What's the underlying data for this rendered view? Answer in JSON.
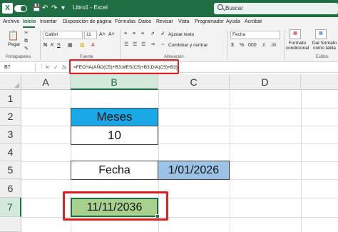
{
  "titlebar": {
    "logo": "X",
    "title": "Libro1 - Excel",
    "search_placeholder": "Buscar"
  },
  "ribbon": {
    "tabs": [
      {
        "label": "Archivo"
      },
      {
        "label": "Inicio"
      },
      {
        "label": "Insertar"
      },
      {
        "label": "Disposición de página"
      },
      {
        "label": "Fórmulas"
      },
      {
        "label": "Datos"
      },
      {
        "label": "Revisar"
      },
      {
        "label": "Vista"
      },
      {
        "label": "Programador"
      },
      {
        "label": "Ayuda"
      },
      {
        "label": "Acrobat"
      }
    ],
    "active_tab": "Inicio",
    "clipboard": {
      "paste_label": "Pegar",
      "group_label": "Portapapeles"
    },
    "font": {
      "name": "Calibri",
      "size": "11",
      "group_label": "Fuente"
    },
    "alignment": {
      "wrap_label": "Ajustar texto",
      "merge_label": "Combinar y centrar",
      "group_label": "Alineación"
    },
    "number": {
      "format": "Fecha"
    },
    "styles": {
      "conditional_label": "Formato condicional",
      "table_label": "Dar formato como tabla",
      "group_label": "Estilos"
    }
  },
  "formula_bar": {
    "name_box": "B7",
    "cancel_symbol": "✕",
    "enter_symbol": "✓",
    "fx_label": "fx",
    "formula": "=FECHA(AÑO(C5)+B3;MES(C5)+B3;DIA(C5)+B3)"
  },
  "grid": {
    "columns": [
      "A",
      "B",
      "C",
      "D"
    ],
    "rows": [
      "1",
      "2",
      "3",
      "4",
      "5",
      "6",
      "7"
    ],
    "selected_cell": "B7",
    "cells": {
      "B2": "Meses",
      "B3": "10",
      "B5": "Fecha",
      "C5": "1/01/2026",
      "B7": "11/11/2036"
    }
  },
  "colors": {
    "excel_green": "#1f6e43",
    "header_fill": "#1aa9e6",
    "date_fill": "#9cc3e5",
    "result_fill": "#a9d18e",
    "highlight": "#e02020"
  }
}
